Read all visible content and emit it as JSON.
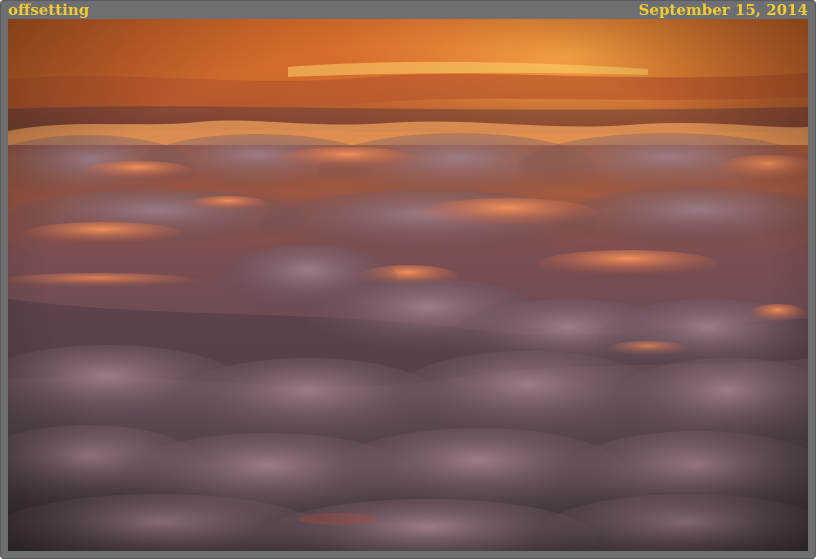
{
  "caption": {
    "title": "offsetting",
    "date": "September 15, 2014"
  },
  "photo": {
    "subject": "sunset over cloud layer",
    "colors": {
      "frame": "#6e6f73",
      "caption_text": "#f2cc2e",
      "sky_glow": "#e07a2a",
      "cloud_highlight": "#f09a5a",
      "cloud_shadow": "#4a3a42"
    }
  }
}
